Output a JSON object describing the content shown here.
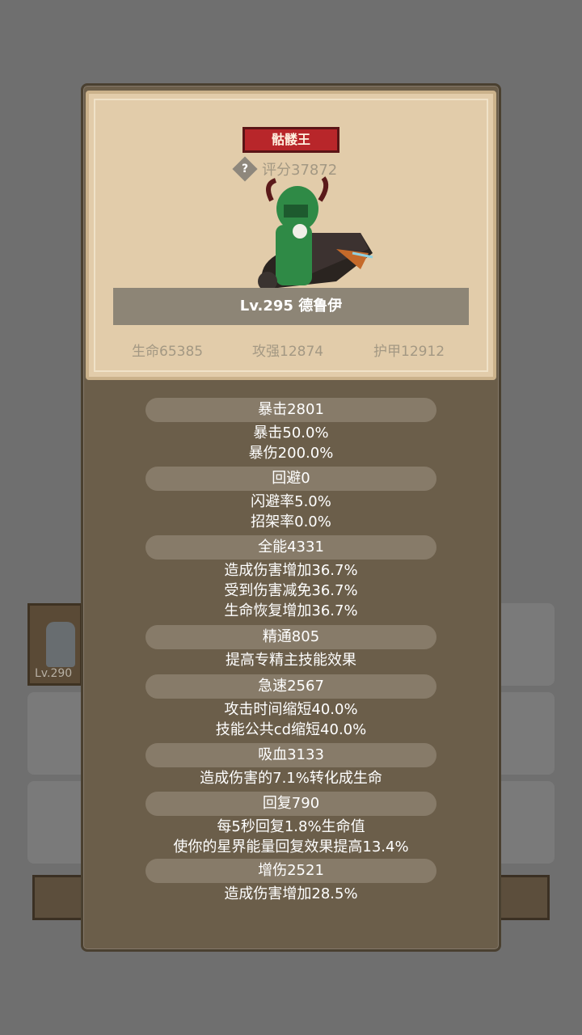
{
  "background": {
    "slot_level": "Lv.290"
  },
  "header": {
    "title_badge": "骷髅王",
    "score": "评分37872",
    "hero_name": "Lv.295 德鲁伊",
    "stats": {
      "hp": "生命65385",
      "attack": "攻强12874",
      "armor": "护甲12912"
    }
  },
  "attributes": [
    {
      "label": "暴击2801",
      "lines": [
        "暴击50.0%",
        "暴伤200.0%"
      ]
    },
    {
      "label": "回避0",
      "lines": [
        "闪避率5.0%",
        "招架率0.0%"
      ]
    },
    {
      "label": "全能4331",
      "lines": [
        "造成伤害增加36.7%",
        "受到伤害减免36.7%",
        "生命恢复增加36.7%"
      ]
    },
    {
      "label": "精通805",
      "lines": [
        "提高专精主技能效果"
      ]
    },
    {
      "label": "急速2567",
      "lines": [
        "攻击时间缩短40.0%",
        "技能公共cd缩短40.0%"
      ]
    },
    {
      "label": "吸血3133",
      "lines": [
        "造成伤害的7.1%转化成生命"
      ]
    },
    {
      "label": "回复790",
      "lines": [
        "每5秒回复1.8%生命值",
        "使你的星界能量回复效果提高13.4%"
      ]
    },
    {
      "label": "增伤2521",
      "lines": [
        "造成伤害增加28.5%"
      ]
    }
  ]
}
